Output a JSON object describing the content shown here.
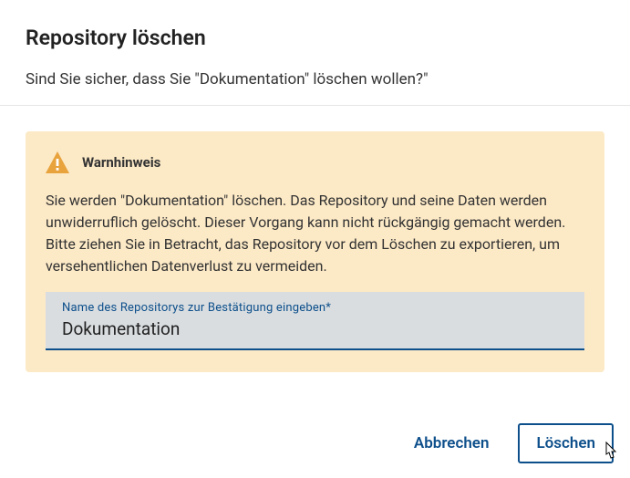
{
  "dialog": {
    "title": "Repository löschen",
    "subtitle": "Sind Sie sicher, dass Sie \"Dokumentation\" löschen wollen?\""
  },
  "warning": {
    "label": "Warnhinweis",
    "text": "Sie werden \"Dokumentation\" löschen. Das Repository und seine Daten werden unwiderruflich gelöscht. Dieser Vorgang kann nicht rückgängig gemacht werden. Bitte ziehen Sie in Betracht, das Repository vor dem Löschen zu exportieren, um versehentlichen Datenverlust zu vermeiden."
  },
  "input": {
    "label": "Name des Repositorys zur Bestätigung eingeben*",
    "value": "Dokumentation"
  },
  "buttons": {
    "cancel": "Abbrechen",
    "delete": "Löschen"
  },
  "colors": {
    "warning_bg": "#fce9c6",
    "warning_icon": "#e8a33d",
    "primary": "#0d4f8b"
  }
}
